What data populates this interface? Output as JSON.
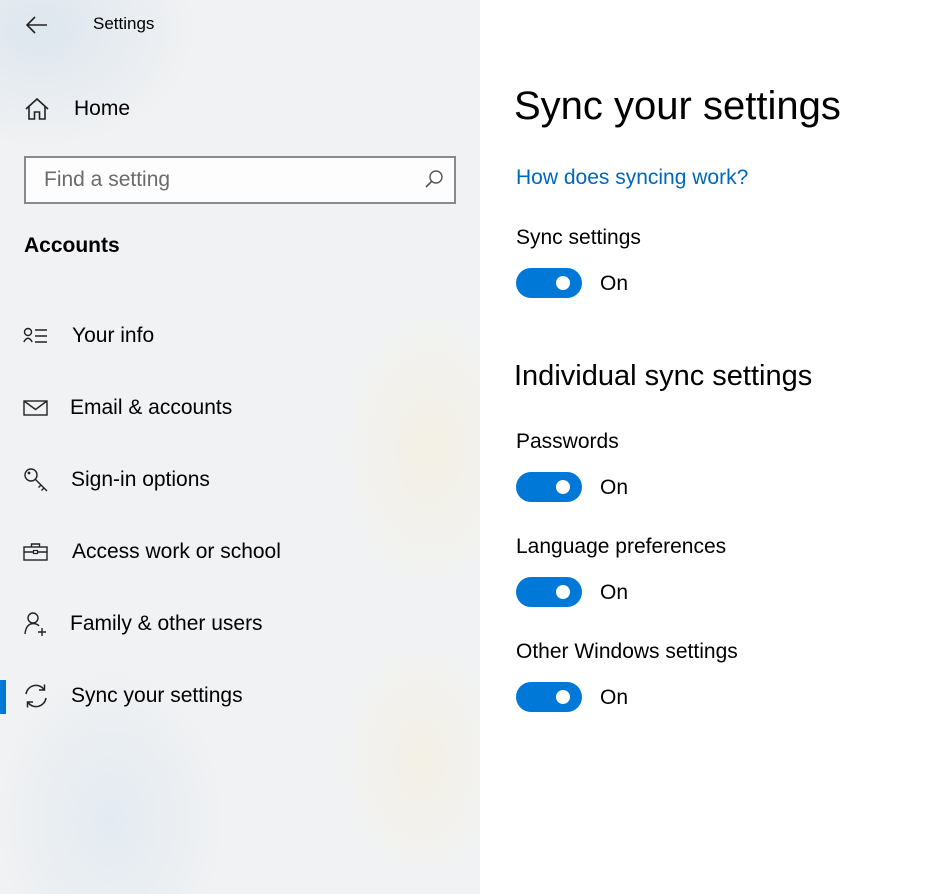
{
  "window": {
    "title": "Settings"
  },
  "sidebar": {
    "home_label": "Home",
    "search": {
      "placeholder": "Find a setting",
      "value": ""
    },
    "section_title": "Accounts",
    "items": [
      {
        "label": "Your info",
        "icon": "contact-info-icon"
      },
      {
        "label": "Email & accounts",
        "icon": "mail-icon"
      },
      {
        "label": "Sign-in options",
        "icon": "key-icon"
      },
      {
        "label": "Access work or school",
        "icon": "briefcase-icon"
      },
      {
        "label": "Family & other users",
        "icon": "add-user-icon"
      },
      {
        "label": "Sync your settings",
        "icon": "sync-icon",
        "selected": true
      }
    ]
  },
  "main": {
    "title": "Sync your settings",
    "help_link": "How does syncing work?",
    "sync_settings": {
      "label": "Sync settings",
      "state": "On"
    },
    "individual_heading": "Individual sync settings",
    "individual": [
      {
        "label": "Passwords",
        "state": "On"
      },
      {
        "label": "Language preferences",
        "state": "On"
      },
      {
        "label": "Other Windows settings",
        "state": "On"
      }
    ]
  },
  "colors": {
    "accent": "#0078d7",
    "link": "#0067c0",
    "sidebar_bg": "#f1f2f3"
  }
}
